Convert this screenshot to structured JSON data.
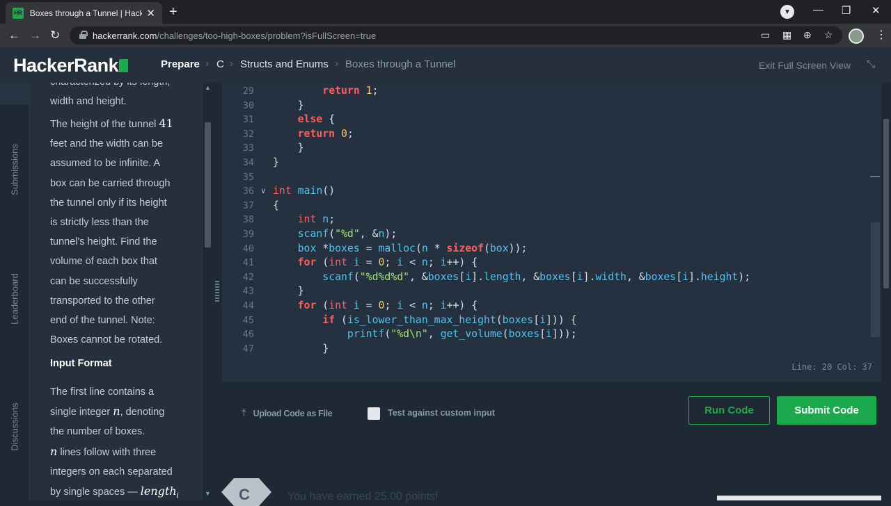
{
  "browser": {
    "tab_title": "Boxes through a Tunnel | HackerRank",
    "favicon_text": "HR",
    "url_host": "hackerrank.com",
    "url_path": "/challenges/too-high-boxes/problem?isFullScreen=true"
  },
  "header": {
    "logo": "HackerRank",
    "breadcrumb": [
      "Prepare",
      "C",
      "Structs and Enums",
      "Boxes through a Tunnel"
    ],
    "exit_fullscreen": "Exit Full Screen View"
  },
  "vertical_tabs": [
    "Submissions",
    "Leaderboard",
    "Discussions"
  ],
  "problem": {
    "para1_lines": [
      "characterized by its length,",
      "width and height."
    ],
    "para2_before": "The height of the tunnel",
    "para2_num": "41",
    "para2_lines": [
      "feet and the width can be",
      "assumed to be infinite. A",
      "box can be carried through",
      "the tunnel only if its height",
      "is strictly less than the",
      "tunnel's height. Find the",
      "volume of each box that",
      "can be successfully",
      "transported to the other",
      "end of the tunnel. Note:",
      "Boxes cannot be rotated."
    ],
    "input_heading": "Input Format",
    "input_line1": "The first line contains a",
    "input_line2_before": "single integer",
    "input_line2_var": "n",
    "input_line2_after": ", denoting",
    "input_line3": "the number of boxes.",
    "input_line4_var": "n",
    "input_line4_after": " lines follow with three",
    "input_line5": "integers on each separated",
    "input_line6_before": "by single spaces — ",
    "input_line6_var": "length",
    "input_line6_sub": "i"
  },
  "editor": {
    "line_numbers": [
      "29",
      "30",
      "31",
      "32",
      "33",
      "34",
      "35",
      "36",
      "37",
      "38",
      "39",
      "40",
      "41",
      "42",
      "43",
      "44",
      "45",
      "46",
      "47"
    ],
    "status": "Line: 20 Col: 37"
  },
  "actions": {
    "upload_label": "Upload Code as File",
    "custom_input_label": "Test against custom input",
    "run_label": "Run Code",
    "submit_label": "Submit Code"
  },
  "footer": {
    "badge_letter": "C",
    "earned_text": "You have earned 25.00 points!"
  },
  "colors": {
    "brand_green": "#1ba94c",
    "header_bg": "#262f3c",
    "editor_bg": "#263140",
    "keyword": "#ff5c5c",
    "function": "#53c3e9",
    "string": "#a5e075"
  }
}
